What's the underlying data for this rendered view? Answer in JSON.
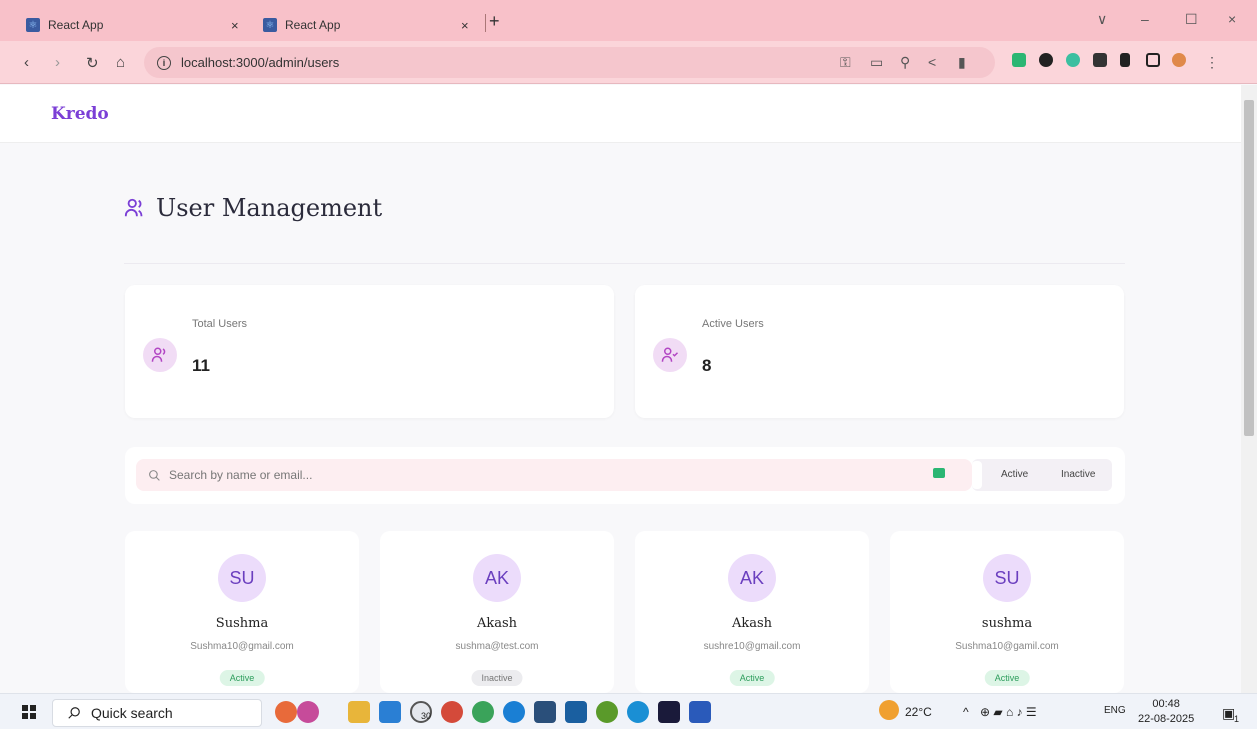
{
  "browser": {
    "tabs": [
      {
        "title": "React App",
        "close": "×"
      },
      {
        "title": "React App",
        "close": "×"
      }
    ],
    "new_tab": "+",
    "url": "localhost:3000/admin/users",
    "info_glyph": "i",
    "window_controls": {
      "chevron": "∨",
      "minimize": "–",
      "restore": "☐",
      "close": "×"
    }
  },
  "app": {
    "brand": "Kredo",
    "page_title": "User Management",
    "stats": {
      "total_label": "Total Users",
      "total_value": "11",
      "active_label": "Active Users",
      "active_value": "8"
    },
    "search": {
      "placeholder": "Search by name or email...",
      "filters": [
        "Active",
        "Inactive"
      ]
    },
    "users": [
      {
        "initials": "SU",
        "name": "Sushma",
        "email": "Sushma10@gmail.com",
        "status": "Active"
      },
      {
        "initials": "AK",
        "name": "Akash",
        "email": "sushma@test.com",
        "status": "Inactive"
      },
      {
        "initials": "AK",
        "name": "Akash",
        "email": "sushre10@gmail.com",
        "status": "Active"
      },
      {
        "initials": "SU",
        "name": "sushma",
        "email": "Sushma10@gamil.com",
        "status": "Active"
      }
    ]
  },
  "taskbar": {
    "search_label": "Quick search",
    "whatsapp_badge": "30",
    "temperature": "22°C",
    "language": "ENG",
    "time": "00:48",
    "date": "22-08-2025",
    "notification_count": "1"
  },
  "colors": {
    "chrome_pink": "#f8c1c9",
    "brand_purple": "#7b3fd6",
    "active_green": "#2d9d5c"
  }
}
